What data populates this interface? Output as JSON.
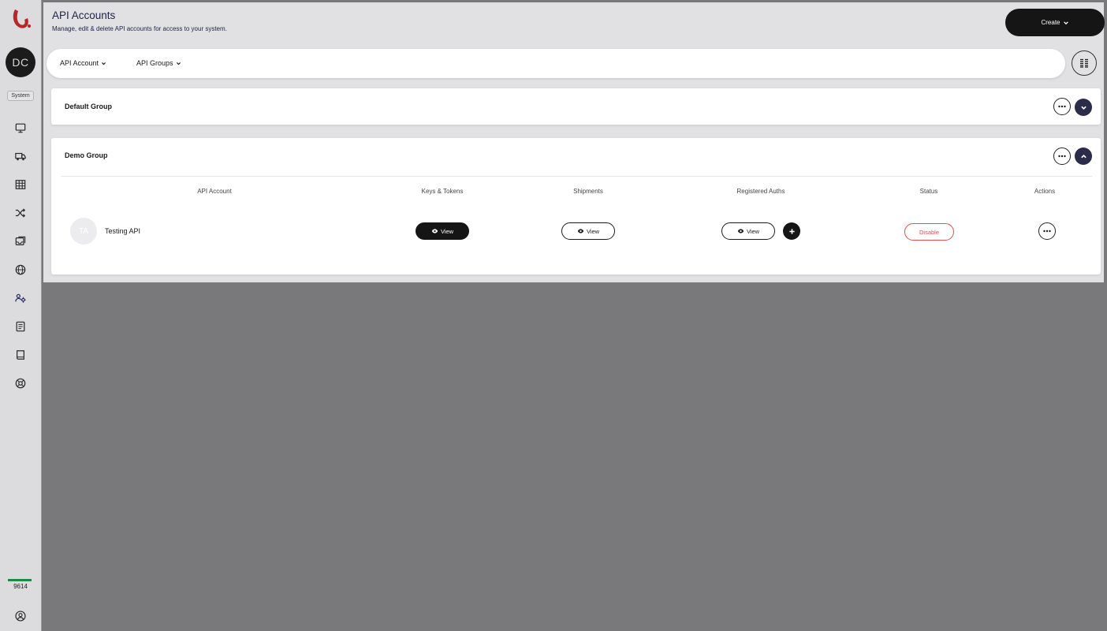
{
  "sidebar": {
    "avatar_initials": "DC",
    "system_label": "System",
    "nav_icons": [
      "monitor-icon",
      "truck-icon",
      "table-icon",
      "shuffle-icon",
      "inbox-icon",
      "globe-icon",
      "users-settings-icon",
      "document-icon",
      "book-icon",
      "support-icon"
    ],
    "active_icon": "users-settings-icon",
    "counter": "9614",
    "counter_color": "#1f8a3c"
  },
  "header": {
    "title": "API Accounts",
    "subtitle": "Manage, edit & delete API accounts for access to your system.",
    "create_label": "Create"
  },
  "filters": {
    "api_account_label": "API Account",
    "api_groups_label": "API Groups"
  },
  "groups": [
    {
      "name": "Default Group",
      "expanded": false
    },
    {
      "name": "Demo Group",
      "expanded": true
    }
  ],
  "table": {
    "columns": [
      "API Account",
      "Keys & Tokens",
      "Shipments",
      "Registered Auths",
      "Status",
      "Actions"
    ],
    "rows": [
      {
        "initials": "TA",
        "name": "Testing API",
        "keys_label": "View",
        "shipments_label": "View",
        "auths_label": "View",
        "status_label": "Disable"
      }
    ]
  },
  "colors": {
    "accent_dark": "#151515",
    "toggle": "#2b2b4a",
    "danger": "#d9534f"
  }
}
